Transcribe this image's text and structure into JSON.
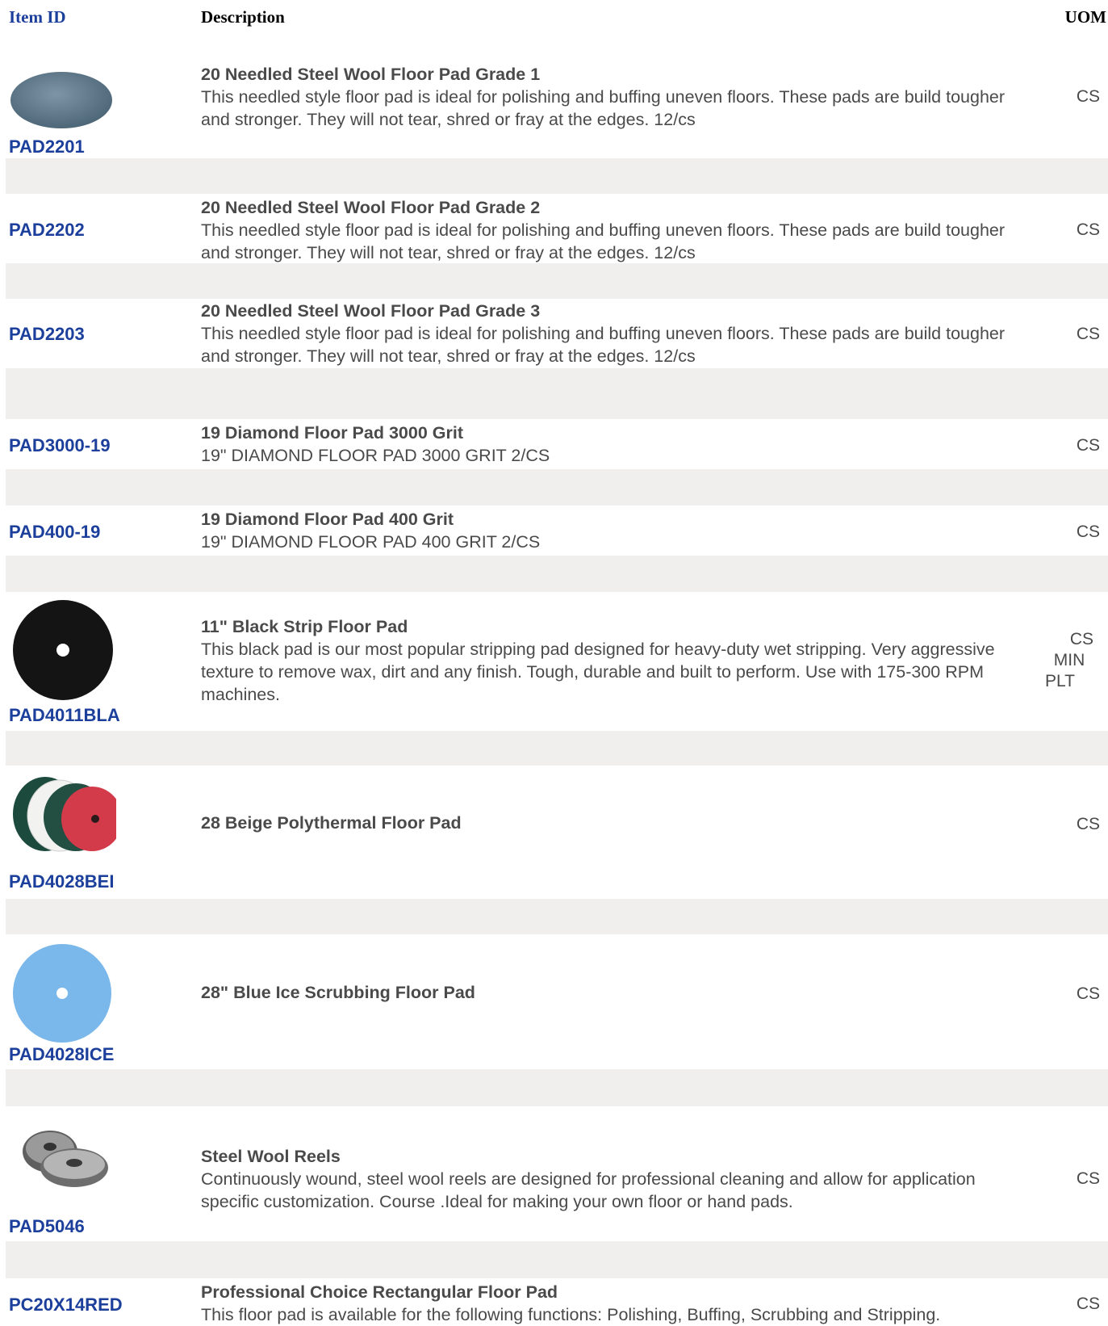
{
  "header": {
    "item_id": "Item ID",
    "description": "Description",
    "uom": "UOM"
  },
  "items": [
    {
      "id": "PAD2201",
      "title": "20 Needled Steel Wool Floor Pad Grade 1",
      "body": "This needled style floor pad is ideal for polishing and buffing uneven floors. These pads are build tougher and stronger. They will not tear, shred or fray at the edges. 12/cs",
      "uom": [
        "CS"
      ],
      "image": "steel-wool-pad-image"
    },
    {
      "id": "PAD2202",
      "title": "20 Needled Steel Wool Floor Pad Grade 2",
      "body": "This needled style floor pad is ideal for polishing and buffing uneven floors. These pads are build tougher and stronger. They will not tear, shred or fray at the edges. 12/cs",
      "uom": [
        "CS"
      ]
    },
    {
      "id": "PAD2203",
      "title": "20 Needled Steel Wool Floor Pad Grade 3",
      "body": "This needled style floor pad is ideal for polishing and buffing uneven floors. These pads are build tougher and stronger. They will not tear, shred or fray at the edges. 12/cs",
      "uom": [
        "CS"
      ]
    },
    {
      "id": "PAD3000-19",
      "title": "19 Diamond Floor Pad 3000 Grit",
      "body": "19\" DIAMOND FLOOR PAD 3000 GRIT 2/CS",
      "uom": [
        "CS"
      ]
    },
    {
      "id": "PAD400-19",
      "title": "19 Diamond Floor Pad 400 Grit",
      "body": "19\" DIAMOND FLOOR PAD 400 GRIT 2/CS",
      "uom": [
        "CS"
      ]
    },
    {
      "id": "PAD4011BLA",
      "title": "11\" Black Strip Floor Pad",
      "body": "This black pad is our most popular stripping pad designed for heavy-duty wet stripping. Very aggressive texture to remove wax, dirt and any finish. Tough, durable and built to perform. Use with 175-300 RPM machines.",
      "uom": [
        "CS",
        "MIN",
        "PLT"
      ],
      "image": "black-pad-image"
    },
    {
      "id": "PAD4028BEI",
      "title": "28 Beige Polythermal Floor Pad",
      "body": "",
      "uom": [
        "CS"
      ],
      "image": "multicolor-pads-image"
    },
    {
      "id": "PAD4028ICE",
      "title": "28\" Blue Ice Scrubbing Floor Pad",
      "body": "",
      "uom": [
        "CS"
      ],
      "image": "blue-pad-image"
    },
    {
      "id": "PAD5046",
      "title": "Steel Wool Reels",
      "body": "Continuously wound, steel wool reels are designed for professional cleaning and allow for application specific customization. Course .Ideal for making your own floor or hand pads.",
      "uom": [
        "CS"
      ],
      "image": "steel-wool-reels-image"
    },
    {
      "id": "PC20X14RED",
      "title": "Professional Choice Rectangular Floor Pad",
      "body": "This floor pad is available for the following functions: Polishing, Buffing, Scrubbing and Stripping.",
      "uom": [
        "CS"
      ]
    }
  ],
  "colors": {
    "link": "#1c3f9c",
    "separator": "#f0efee",
    "text": "#4a4a4a"
  }
}
